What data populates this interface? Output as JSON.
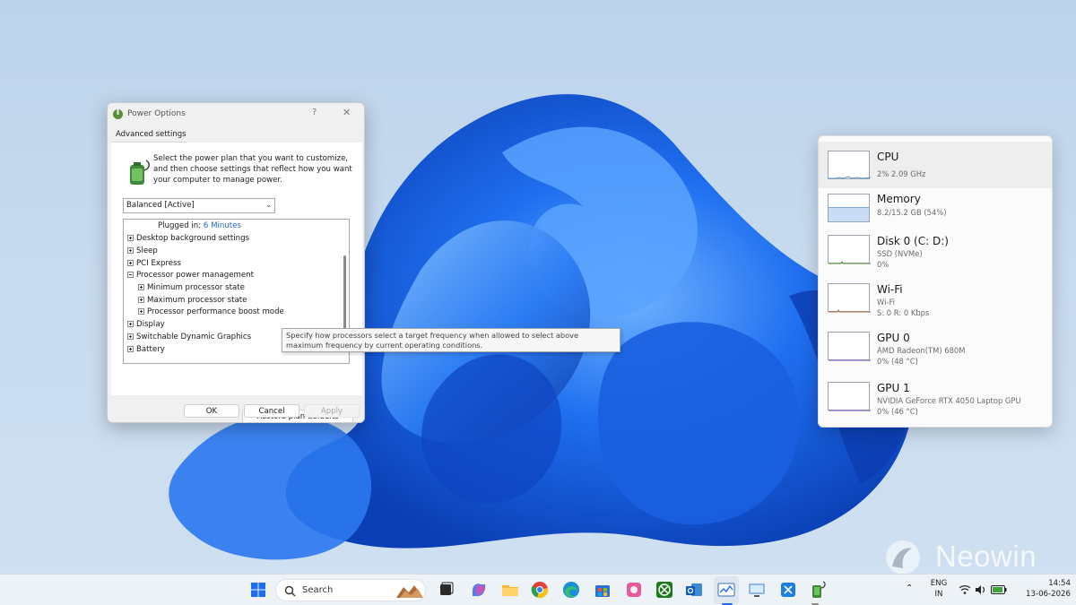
{
  "power_options": {
    "title": "Power Options",
    "help": "?",
    "close": "✕",
    "tab": "Advanced settings",
    "intro": "Select the power plan that you want to customize, and then choose settings that reflect how you want your computer to manage power.",
    "plan": "Balanced [Active]",
    "tree": {
      "plugged_in_label": "Plugged in:",
      "plugged_in_value": "6 Minutes",
      "items": [
        "Desktop background settings",
        "Sleep",
        "PCI Express",
        "Processor power management",
        "Minimum processor state",
        "Maximum processor state",
        "Processor performance boost mode",
        "Display",
        "Switchable Dynamic Graphics",
        "Battery"
      ]
    },
    "restore_button": "Restore plan defaults",
    "ok_button": "OK",
    "cancel_button": "Cancel",
    "apply_button": "Apply"
  },
  "tooltip": "Specify how processors select a target frequency when allowed to select above maximum frequency by current operating conditions.",
  "performance": {
    "items": [
      {
        "name": "CPU",
        "detail": "2%  2.09 GHz",
        "usage_percent": 2,
        "selected": true
      },
      {
        "name": "Memory",
        "detail": "8.2/15.2 GB (54%)",
        "usage_percent": 54,
        "selected": false
      },
      {
        "name": "Disk 0 (C: D:)",
        "detail": "SSD (NVMe)",
        "detail2": "0%",
        "usage_percent": 0,
        "selected": false
      },
      {
        "name": "Wi-Fi",
        "detail": "Wi-Fi",
        "detail2": "S: 0  R: 0 Kbps",
        "usage_percent": 0,
        "selected": false
      },
      {
        "name": "GPU 0",
        "detail": "AMD Radeon(TM) 680M",
        "detail2": "0%  (48 °C)",
        "usage_percent": 0,
        "selected": false
      },
      {
        "name": "GPU 1",
        "detail": "NVIDIA GeForce RTX 4050 Laptop GPU",
        "detail2": "0%  (46 °C)",
        "usage_percent": 0,
        "selected": false
      }
    ]
  },
  "watermark": "Neowin",
  "taskbar": {
    "search_label": "Search",
    "language": "ENG",
    "region": "IN",
    "time": "14:54",
    "date": "13-06-2026",
    "icons": [
      "start-icon",
      "search-icon",
      "widgets-icon",
      "task-view-icon",
      "copilot-icon",
      "file-explorer-icon",
      "chrome-icon",
      "edge-icon",
      "store-icon",
      "photos-icon",
      "xbox-icon",
      "outlook-icon",
      "task-manager-icon",
      "remote-desktop-icon",
      "snipping-tool-icon",
      "power-options-icon"
    ]
  },
  "colors": {
    "link": "#1a66c9",
    "accent": "#1e5fd8",
    "memory_fill": "#c8ddf5"
  }
}
